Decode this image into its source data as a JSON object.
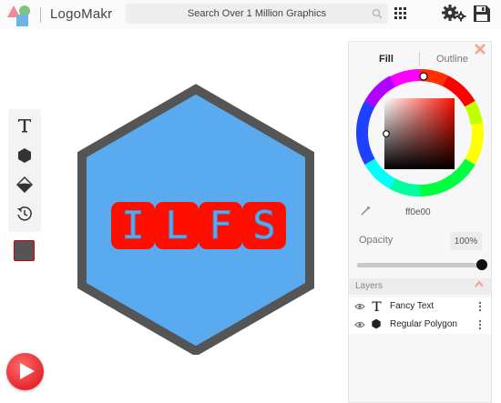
{
  "app": {
    "name": "LogoMakr"
  },
  "search": {
    "placeholder": "Search Over 1 Million Graphics"
  },
  "toolbar": {
    "tools": [
      "text-tool",
      "shape-tool",
      "fill-tool",
      "history-tool"
    ]
  },
  "canvas": {
    "logo_text": "ILFS",
    "letters": [
      "I",
      "L",
      "F",
      "S"
    ],
    "hexagon_fill": "#5aaaf0",
    "hexagon_stroke": "#555555",
    "tile_fill": "#ff0e00",
    "letter_fill": "#5aaaf0"
  },
  "panel": {
    "tabs": {
      "fill": "Fill",
      "outline": "Outline"
    },
    "color_hex": "ff0e00",
    "opacity_label": "Opacity",
    "opacity_value": "100%",
    "layers_title": "Layers",
    "layers": [
      {
        "icon": "text-icon",
        "name": "Fancy Text"
      },
      {
        "icon": "hexagon-icon",
        "name": "Regular Polygon"
      }
    ]
  },
  "colors": {
    "accent_close": "#f4a08b",
    "current_swatch": "#555555"
  }
}
